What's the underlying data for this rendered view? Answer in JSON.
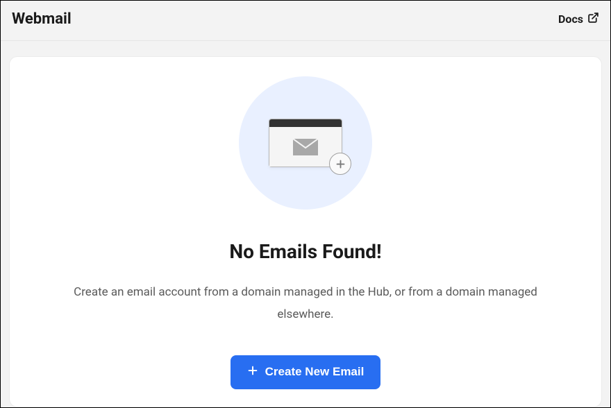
{
  "header": {
    "title": "Webmail",
    "docs_label": "Docs"
  },
  "empty_state": {
    "heading": "No Emails Found!",
    "description": "Create an email account from a domain managed in the Hub, or from a domain managed elsewhere.",
    "button_label": "Create New Email"
  }
}
